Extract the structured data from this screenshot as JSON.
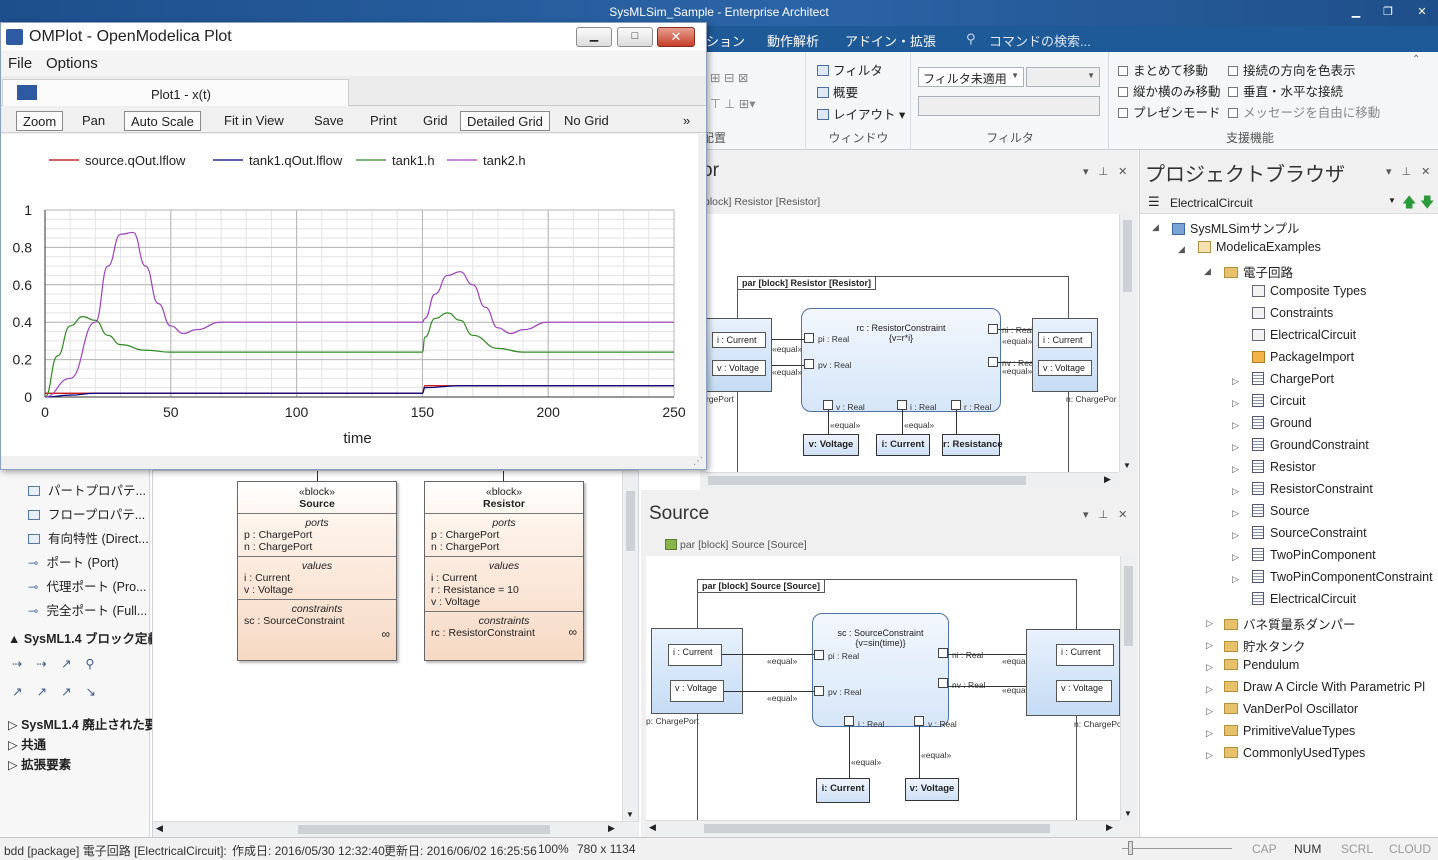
{
  "app": {
    "title": "SysMLSim_Sample - Enterprise Architect",
    "menu": [
      "ション",
      "動作解析",
      "アドイン・拡張",
      "コマンドの検索..."
    ]
  },
  "ribbon": {
    "diagram_group_label": "配置",
    "window_group": {
      "label": "ウィンドウ",
      "items": [
        "フィルタ",
        "概要",
        "レイアウト"
      ]
    },
    "filter_group": {
      "label": "フィルタ",
      "combo_value": "フィルタ未適用"
    },
    "support_group": {
      "label": "支援機能",
      "left": [
        "まとめて移動",
        "縦か横のみ移動",
        "プレゼンモード"
      ],
      "right": [
        "接続の方向を色表示",
        "垂直・水平な接続",
        "メッセージを自由に移動"
      ]
    }
  },
  "resistor_panel": {
    "title_fragment": "or",
    "breadcrumb": "block] Resistor [Resistor]",
    "frame_title": "par [block] Resistor [Resistor]",
    "constraint": {
      "name": "rc : ResistorConstraint",
      "expr": "{v=r*i}",
      "pi": "pi : Real",
      "pv": "pv : Real",
      "v": "v : Real",
      "i": "i : Real",
      "r": "r : Real",
      "ni": "ni : Real",
      "nv": "nv : Real"
    },
    "left_pins": [
      "i : Current",
      "v : Voltage"
    ],
    "right_pins": [
      "i : Current",
      "v : Voltage"
    ],
    "equal": "«equal»",
    "left_port": "rgePort",
    "right_port": "n: ChargePor",
    "bottom": [
      "v: Voltage",
      "i: Current",
      "r: Resistance"
    ]
  },
  "source_panel": {
    "title": "Source",
    "breadcrumb": "par [block] Source [Source]",
    "frame_title": "par [block] Source [Source]",
    "constraint": {
      "name": "sc : SourceConstraint",
      "expr": "{v=sin(time)}",
      "pi": "pi : Real",
      "pv": "pv : Real",
      "i": "i : Real",
      "v": "v : Real",
      "ni": "ni : Real",
      "nv": "nv : Real"
    },
    "left_pins": [
      "i : Current",
      "v : Voltage"
    ],
    "right_pins": [
      "i : Current",
      "v : Voltage"
    ],
    "equal": "«equal»",
    "left_port": "p: ChargePort",
    "right_port": "n: ChargePort",
    "bottom": [
      "i: Current",
      "v: Voltage"
    ]
  },
  "project_browser": {
    "title": "プロジェクトブラウザ",
    "selector": "ElectricalCircuit",
    "root": "SysMLSimサンプル",
    "pkg": "ModelicaExamples",
    "folder": "電子回路",
    "children": [
      "Composite Types",
      "Constraints",
      "ElectricalCircuit",
      "PackageImport",
      "ChargePort",
      "Circuit",
      "Ground",
      "GroundConstraint",
      "Resistor",
      "ResistorConstraint",
      "Source",
      "SourceConstraint",
      "TwoPinComponent",
      "TwoPinComponentConstraint",
      "ElectricalCircuit"
    ],
    "folders": [
      "バネ質量系ダンパー",
      "貯水タンク",
      "Pendulum",
      "Draw A Circle With Parametric Pl",
      "VanDerPol Oscillator",
      "PrimitiveValueTypes",
      "CommonlyUsedTypes"
    ]
  },
  "toolbox": {
    "items": [
      "パートプロパテ...",
      "フロープロパテ...",
      "有向特性 (Direct...",
      "ポート (Port)",
      "代理ポート (Pro...",
      "完全ポート (Full..."
    ],
    "section": "SysML1.4 ブロック定義",
    "bottom_sections": [
      "SysML1.4 廃止された要",
      "共通",
      "拡張要素"
    ]
  },
  "bdd": {
    "source": {
      "stereo": "«block»",
      "name": "Source",
      "ports_h": "ports",
      "ports": [
        "p : ChargePort",
        "n : ChargePort"
      ],
      "values_h": "values",
      "values": [
        "i : Current",
        "v : Voltage"
      ],
      "constraints_h": "constraints",
      "constraints": [
        "sc : SourceConstraint"
      ]
    },
    "resistor": {
      "stereo": "«block»",
      "name": "Resistor",
      "ports_h": "ports",
      "ports": [
        "p : ChargePort",
        "n : ChargePort"
      ],
      "values_h": "values",
      "values": [
        "i : Current",
        "r : Resistance = 10",
        "v : Voltage"
      ],
      "constraints_h": "constraints",
      "constraints": [
        "rc : ResistorConstraint"
      ]
    }
  },
  "omplot": {
    "title": "OMPlot - OpenModelica Plot",
    "menu": [
      "File",
      "Options"
    ],
    "tab": "Plot1 - x(t)",
    "toolbar": [
      "Zoom",
      "Pan",
      "Auto Scale",
      "Fit in View",
      "Save",
      "Print",
      "Grid",
      "Detailed Grid",
      "No Grid"
    ],
    "more": "»"
  },
  "chart_data": {
    "type": "line",
    "xlabel": "time",
    "xlim": [
      0,
      250
    ],
    "ylim": [
      0,
      1
    ],
    "xticks": [
      0,
      50,
      100,
      150,
      200,
      250
    ],
    "yticks": [
      "0",
      "0.2",
      "0.4",
      "0.6",
      "0.8",
      "1"
    ],
    "grid": "detailed",
    "legend": "top",
    "series": [
      {
        "name": "source.qOut.lflow",
        "color": "#c00000",
        "x": [
          0,
          5,
          10,
          15,
          20,
          30,
          150,
          151,
          160,
          170,
          250
        ],
        "y": [
          0.02,
          0.02,
          0.02,
          0.02,
          0.02,
          0.02,
          0.02,
          0.06,
          0.06,
          0.06,
          0.06
        ]
      },
      {
        "name": "tank1.qOut.lflow",
        "color": "#000080",
        "x": [
          0,
          10,
          20,
          30,
          150,
          151,
          165,
          250
        ],
        "y": [
          0,
          0.01,
          0.02,
          0.02,
          0.02,
          0.05,
          0.06,
          0.06
        ]
      },
      {
        "name": "tank1.h",
        "color": "#2e8b22",
        "x": [
          0,
          5,
          10,
          15,
          20,
          25,
          30,
          40,
          50,
          60,
          150,
          151,
          155,
          160,
          165,
          170,
          180,
          190,
          200,
          250
        ],
        "y": [
          0,
          0.22,
          0.38,
          0.43,
          0.41,
          0.33,
          0.28,
          0.25,
          0.24,
          0.24,
          0.24,
          0.32,
          0.42,
          0.45,
          0.41,
          0.33,
          0.26,
          0.24,
          0.24,
          0.24
        ]
      },
      {
        "name": "tank2.h",
        "color": "#a040c0",
        "x": [
          0,
          10,
          20,
          25,
          30,
          35,
          40,
          45,
          50,
          55,
          60,
          70,
          80,
          150,
          151,
          155,
          160,
          165,
          170,
          175,
          180,
          185,
          190,
          200,
          210,
          220,
          250
        ],
        "y": [
          0,
          0.1,
          0.4,
          0.7,
          0.87,
          0.88,
          0.7,
          0.5,
          0.38,
          0.34,
          0.36,
          0.4,
          0.4,
          0.4,
          0.42,
          0.55,
          0.65,
          0.67,
          0.6,
          0.48,
          0.37,
          0.34,
          0.36,
          0.4,
          0.4,
          0.4,
          0.4
        ]
      }
    ]
  },
  "status": {
    "left": "bdd [package] 電子回路 [ElectricalCircuit]:",
    "created": "作成日: 2016/05/30 12:32:40",
    "updated": "更新日: 2016/06/02 16:25:56",
    "zoom": "100%",
    "size": "780 x 1134",
    "caps": [
      "CAP",
      "NUM",
      "SCRL",
      "CLOUD"
    ]
  }
}
